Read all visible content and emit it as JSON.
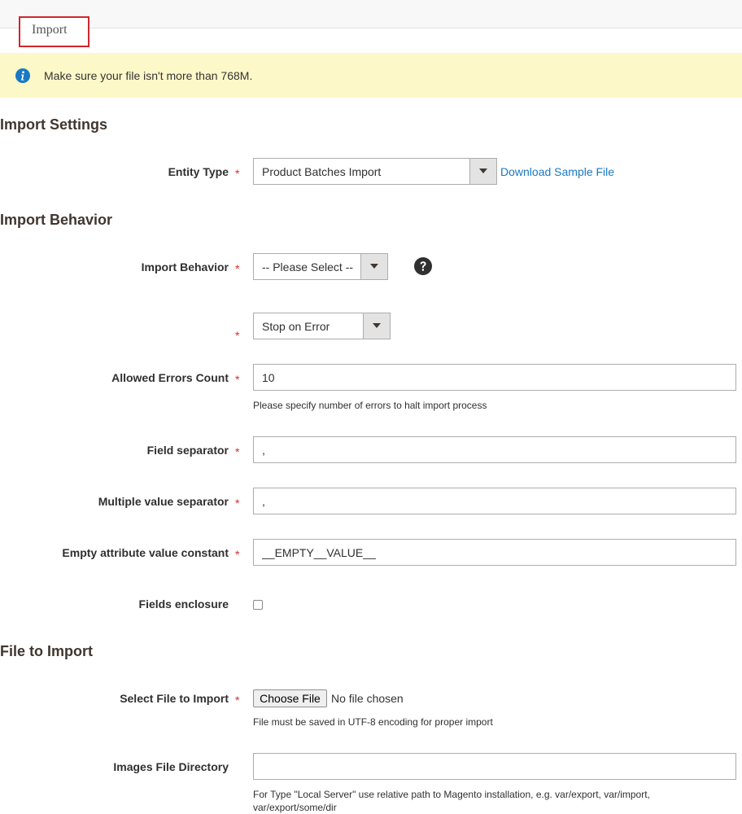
{
  "tab": {
    "label": "Import"
  },
  "notice": {
    "text": "Make sure your file isn't more than 768M."
  },
  "sections": {
    "import_settings": "Import Settings",
    "import_behavior": "Import Behavior",
    "file_to_import": "File to Import"
  },
  "entity_type": {
    "label": "Entity Type",
    "value": "Product Batches Import",
    "sample_link": "Download Sample File"
  },
  "behavior": {
    "label": "Import Behavior",
    "value": "-- Please Select --"
  },
  "validation_strategy": {
    "value": "Stop on Error"
  },
  "allowed_errors": {
    "label": "Allowed Errors Count",
    "value": "10",
    "note": "Please specify number of errors to halt import process"
  },
  "field_separator": {
    "label": "Field separator",
    "value": ","
  },
  "multiple_value_separator": {
    "label": "Multiple value separator",
    "value": ","
  },
  "empty_attribute": {
    "label": "Empty attribute value constant",
    "value": "__EMPTY__VALUE__"
  },
  "fields_enclosure": {
    "label": "Fields enclosure",
    "checked": false
  },
  "file_select": {
    "label": "Select File to Import",
    "button": "Choose File",
    "status": "No file chosen",
    "note": "File must be saved in UTF-8 encoding for proper import"
  },
  "images_dir": {
    "label": "Images File Directory",
    "value": "",
    "note_line1": "For Type \"Local Server\" use relative path to Magento installation, e.g. var/export, var/import,",
    "note_line2": "var/export/some/dir"
  },
  "required_mark": "*",
  "colors": {
    "notice_bg": "#fdf8c8",
    "link": "#1979c3",
    "required": "#e22626",
    "tab_outline": "#d0262d",
    "info_icon": "#1979c3"
  },
  "icons": {
    "notice": "info-icon",
    "dropdown": "caret-down-icon",
    "help": "question-circle-icon"
  }
}
